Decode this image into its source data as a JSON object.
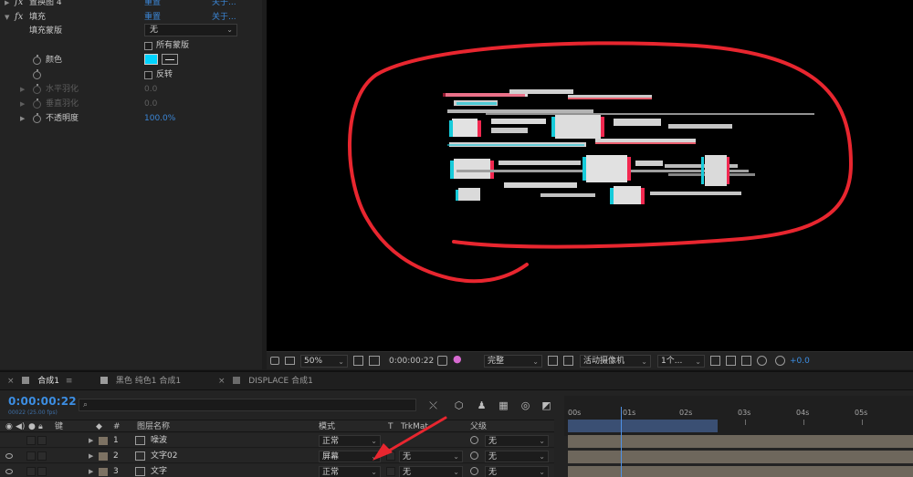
{
  "effects": {
    "rows": [
      {
        "name": "置换图 4",
        "values": [
          "重置",
          "关于..."
        ],
        "dim": true
      },
      {
        "name": "填充",
        "values": [
          "重置",
          "关于..."
        ]
      },
      {
        "name": "填充蒙版",
        "dropdown": "无"
      },
      {
        "checkbox": "所有蒙版"
      },
      {
        "name": "颜色",
        "color": "#00d4ff"
      },
      {
        "checkbox": "反转"
      },
      {
        "name": "水平羽化",
        "value": "0.0",
        "dim": true
      },
      {
        "name": "垂直羽化",
        "value": "0.0",
        "dim": true
      },
      {
        "name": "不透明度",
        "value": "100.0%"
      }
    ]
  },
  "viewer": {
    "zoom": "50%",
    "timecode": "0:00:00:22",
    "quality": "完整",
    "camera": "活动摄像机",
    "views": "1个...",
    "exposure": "+0.0"
  },
  "timeline": {
    "tabs": [
      {
        "label": "合成1",
        "menu": "≡",
        "active": true
      },
      {
        "label": "黑色 纯色1 合成1",
        "color": "#9c9c9c"
      },
      {
        "label": "DISPLACE 合成1",
        "color": "#6b6b6b"
      }
    ],
    "timecode": "0:00:00:22",
    "fps": "00022 (25.00 fps)",
    "search_placeholder": "",
    "columns": {
      "key": "键",
      "num": "#",
      "layer_name": "图层名称",
      "mode": "模式",
      "t": "T",
      "trkmat": "TrkMat",
      "parent": "父级"
    },
    "layers": [
      {
        "num": "1",
        "name": "噪波",
        "mode": "正常",
        "trkmat": "",
        "parent": "无"
      },
      {
        "num": "2",
        "name": "文字02",
        "mode": "屏幕",
        "trkmat": "无",
        "parent": "无"
      },
      {
        "num": "3",
        "name": "文字",
        "mode": "正常",
        "trkmat": "无",
        "parent": "无"
      }
    ],
    "ruler": [
      "00s",
      "01s",
      "02s",
      "03s",
      "04s",
      "05s"
    ]
  },
  "colors": {
    "accent": "#3c8ee3",
    "annotation": "#e8262f"
  }
}
